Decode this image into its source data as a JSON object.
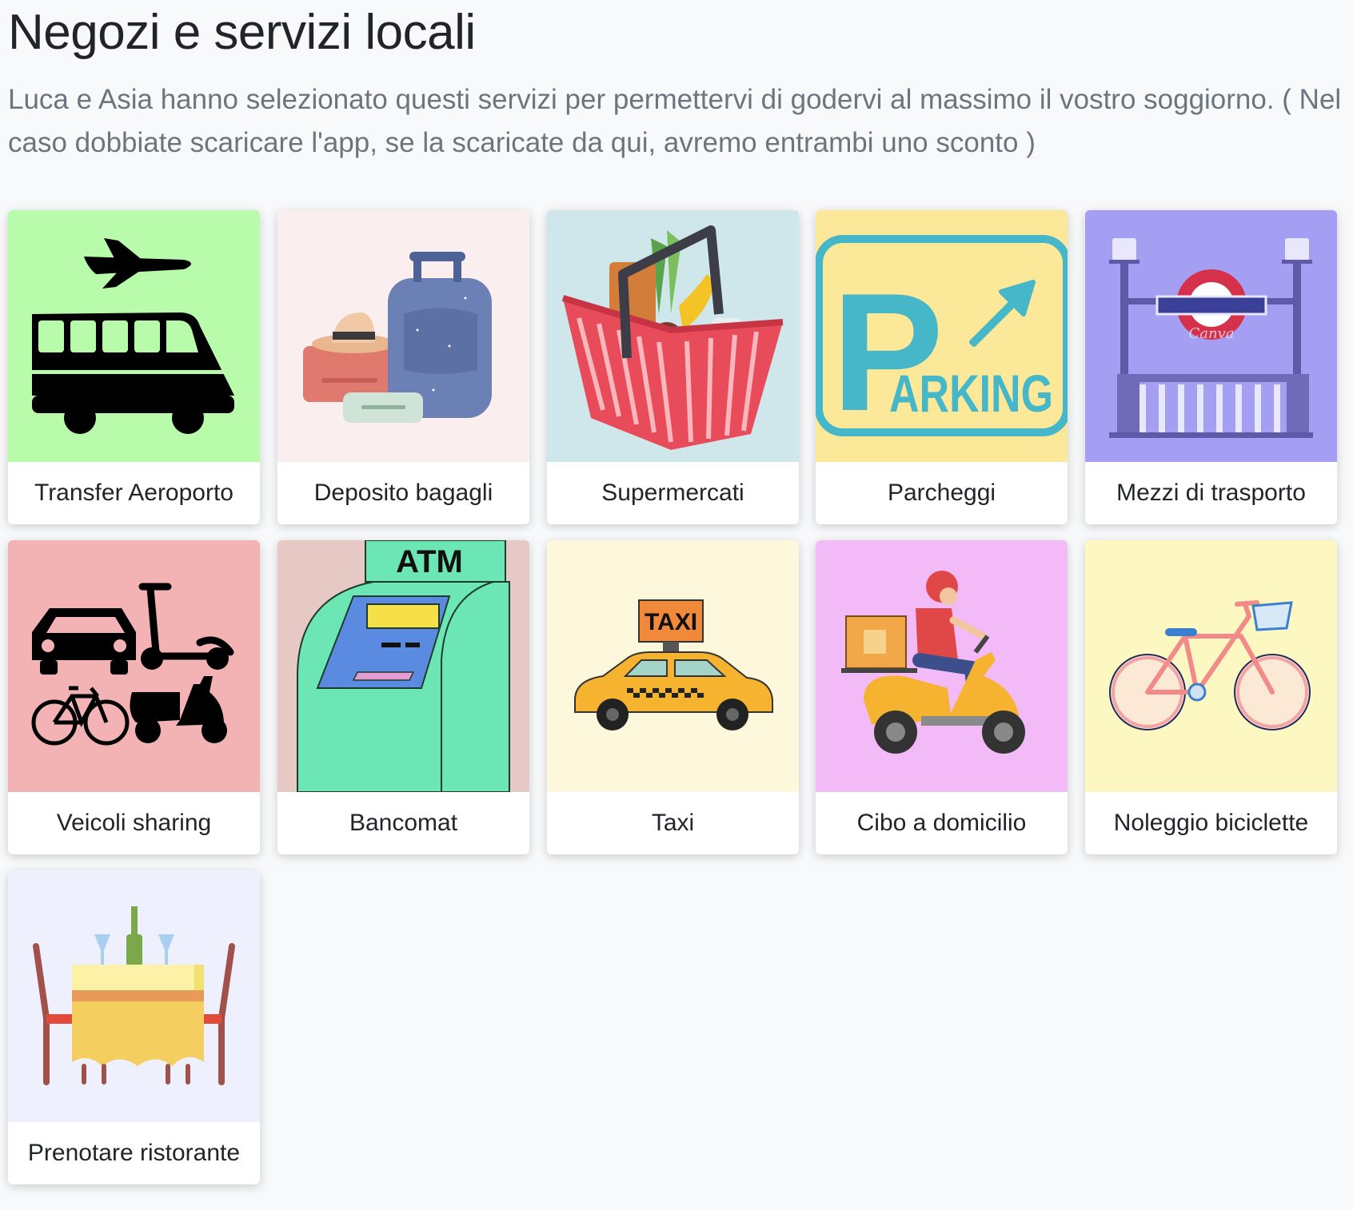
{
  "header": {
    "title": "Negozi e servizi locali",
    "description": "Luca e Asia hanno selezionato questi servizi per permettervi di godervi al massimo il vostro soggiorno.  ( Nel caso dobbiate scaricare l'app, se la scaricate da qui, avremo entrambi uno sconto )"
  },
  "services": [
    {
      "label": "Transfer Aeroporto",
      "icon": "airport-shuttle-icon",
      "bg": "#b8fbaa"
    },
    {
      "label": "Deposito bagagli",
      "icon": "luggage-icon",
      "bg": "#fbeeee"
    },
    {
      "label": "Supermercati",
      "icon": "shopping-basket-icon",
      "bg": "#cfe6ea"
    },
    {
      "label": "Parcheggi",
      "icon": "parking-sign-icon",
      "bg": "#fbe899"
    },
    {
      "label": "Mezzi di trasporto",
      "icon": "metro-station-icon",
      "bg": "#a59ff3"
    },
    {
      "label": "Veicoli sharing",
      "icon": "vehicle-sharing-icon",
      "bg": "#f3b3b4"
    },
    {
      "label": "Bancomat",
      "icon": "atm-icon",
      "bg": "#e6c8c4"
    },
    {
      "label": "Taxi",
      "icon": "taxi-icon",
      "bg": "#fdf7dc"
    },
    {
      "label": "Cibo a domicilio",
      "icon": "food-delivery-icon",
      "bg": "#f2bbf7"
    },
    {
      "label": "Noleggio biciclette",
      "icon": "bicycle-icon",
      "bg": "#fdf7c1"
    },
    {
      "label": "Prenotare ristorante",
      "icon": "restaurant-table-icon",
      "bg": "#eef1fd"
    }
  ],
  "graphics": {
    "parking_sign_letter": "P",
    "parking_sign_text": "ARKING",
    "atm_sign_text": "ATM",
    "taxi_sign_text": "TAXI",
    "metro_watermark": "Canva"
  }
}
